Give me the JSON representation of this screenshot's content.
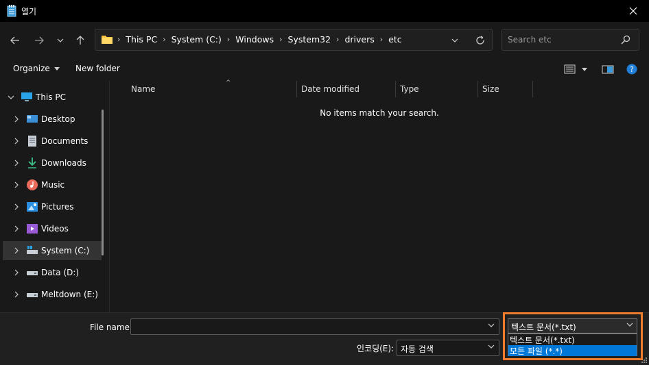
{
  "window": {
    "title": "열기",
    "accent": "#0078d7",
    "highlight_color": "#f07d2d"
  },
  "nav": {
    "back_icon": "arrow-left-icon",
    "forward_icon": "arrow-right-icon",
    "recent_icon": "chevron-down-icon",
    "up_icon": "arrow-up-icon"
  },
  "address": {
    "crumbs": [
      "This PC",
      "System (C:)",
      "Windows",
      "System32",
      "drivers",
      "etc"
    ]
  },
  "search": {
    "placeholder": "Search etc"
  },
  "toolbar": {
    "organize_label": "Organize",
    "new_folder_label": "New folder"
  },
  "sidebar": {
    "items": [
      {
        "label": "This PC",
        "icon": "computer-icon"
      },
      {
        "label": "Desktop",
        "icon": "desktop-icon"
      },
      {
        "label": "Documents",
        "icon": "documents-icon"
      },
      {
        "label": "Downloads",
        "icon": "downloads-icon"
      },
      {
        "label": "Music",
        "icon": "music-icon"
      },
      {
        "label": "Pictures",
        "icon": "pictures-icon"
      },
      {
        "label": "Videos",
        "icon": "videos-icon"
      },
      {
        "label": "System (C:)",
        "icon": "system-drive-icon"
      },
      {
        "label": "Data (D:)",
        "icon": "drive-icon"
      },
      {
        "label": "Meltdown (E:)",
        "icon": "drive-icon"
      }
    ]
  },
  "columns": {
    "name": "Name",
    "date_modified": "Date modified",
    "type": "Type",
    "size": "Size"
  },
  "content": {
    "empty_message": "No items match your search."
  },
  "footer": {
    "file_name_label": "File name:",
    "file_name_value": "",
    "encoding_label": "인코딩(E):",
    "encoding_value": "자동 검색",
    "file_type_value": "텍스트 문서(*.txt)",
    "file_type_options": [
      "텍스트 문서(*.txt)",
      "모든 파일  (*.*)"
    ]
  }
}
